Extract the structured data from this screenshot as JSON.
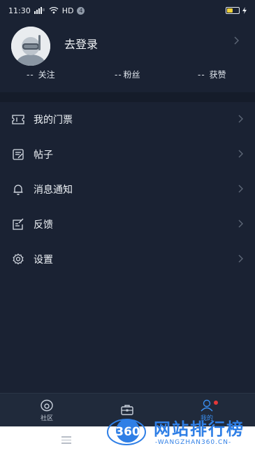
{
  "status_bar": {
    "time": "11:30",
    "network": "HD",
    "badge": "4",
    "battery_level": 0.45
  },
  "profile": {
    "login_label": "去登录"
  },
  "stats": [
    {
      "value": "--",
      "label": "关注"
    },
    {
      "value": "--",
      "label": "粉丝"
    },
    {
      "value": "--",
      "label": "获赞"
    }
  ],
  "menu": [
    {
      "label": "我的门票",
      "icon": "ticket-icon"
    },
    {
      "label": "帖子",
      "icon": "post-icon"
    },
    {
      "label": "消息通知",
      "icon": "bell-icon"
    },
    {
      "label": "反馈",
      "icon": "feedback-icon"
    },
    {
      "label": "设置",
      "icon": "gear-icon"
    }
  ],
  "tab_bar": {
    "tabs": [
      {
        "label": "社区",
        "icon": "community-icon"
      },
      {
        "label": "",
        "icon": "toolbox-icon"
      },
      {
        "label": "我的",
        "icon": "profile-icon",
        "active": true
      }
    ]
  },
  "watermark": {
    "logo_text": "360",
    "title": "网站排行榜",
    "subtitle": "-WANGZHAN360.CN-"
  },
  "colors": {
    "background": "#1a2233",
    "accent": "#3a8eef",
    "notification_dot": "#e53838"
  }
}
